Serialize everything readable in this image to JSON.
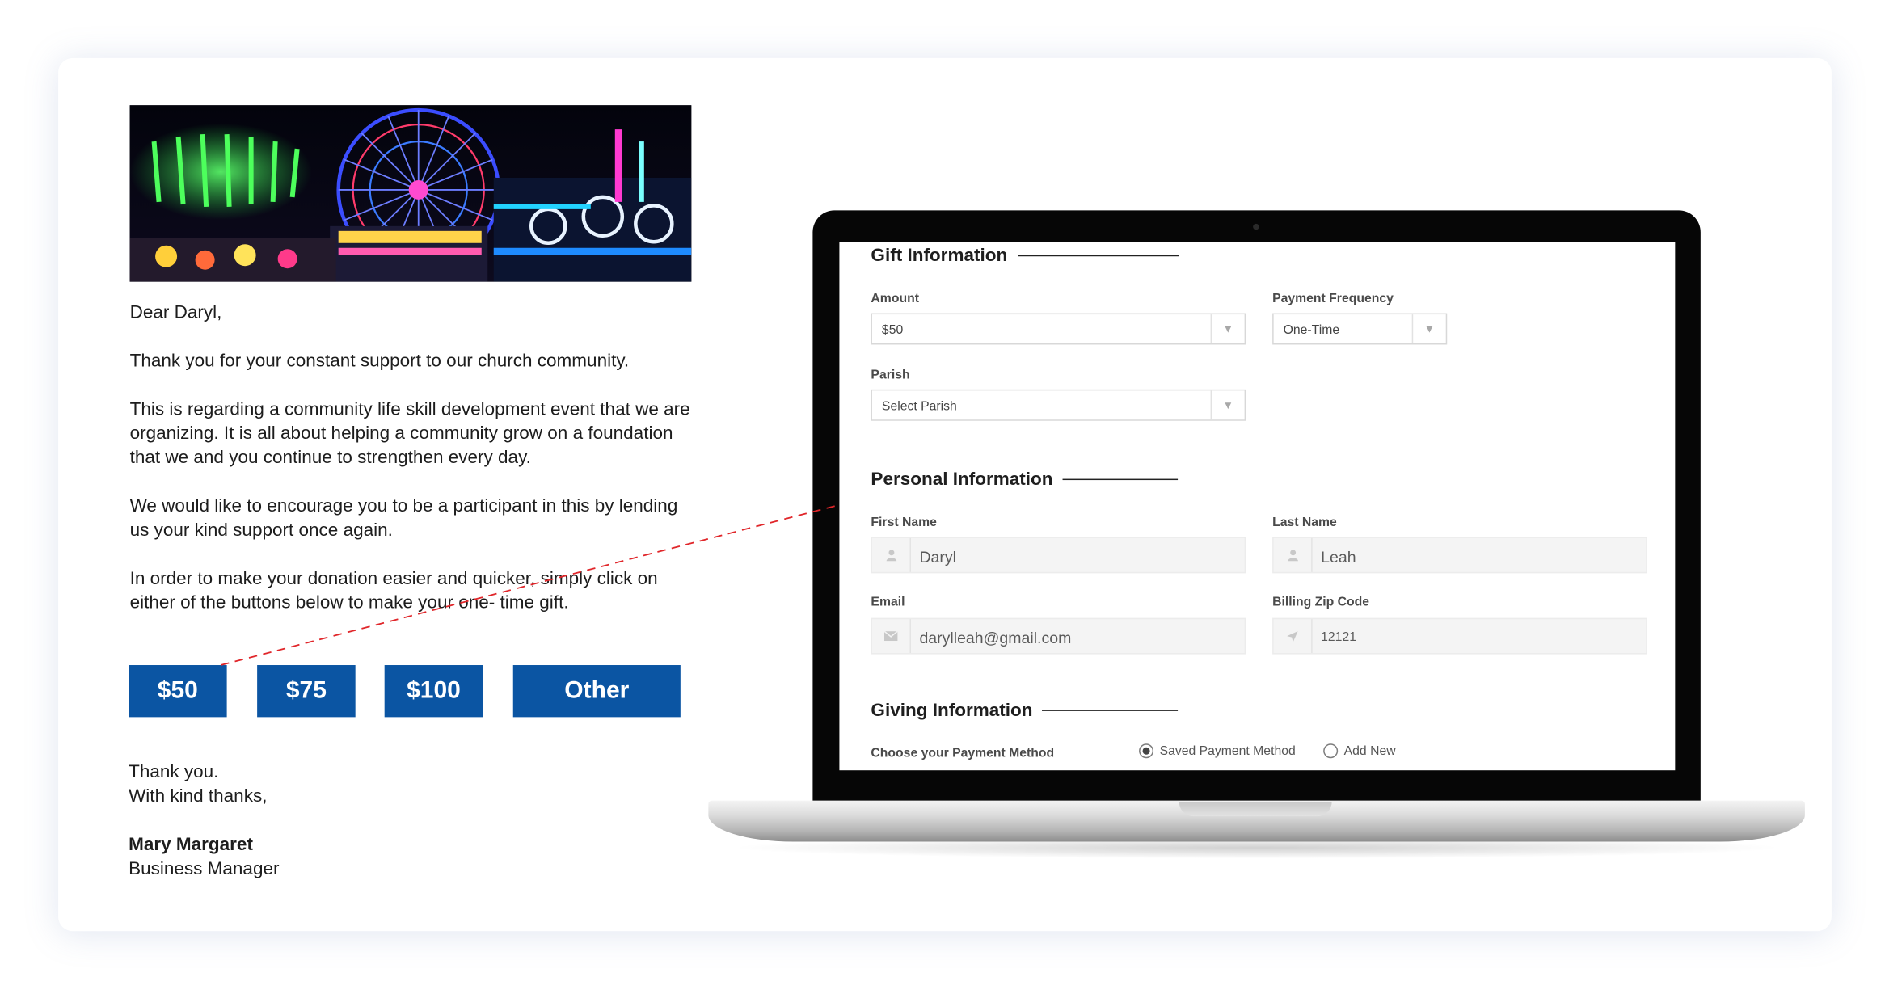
{
  "letter": {
    "greeting": "Dear Daryl,",
    "paragraphs": [
      "Thank you for your constant support to our church community.",
      "This is regarding a community life skill development event that we are organizing. It is all about helping a community grow on a foundation that we and you continue to strengthen every day.",
      "We would like to encourage you to be a participant in this by lending us your kind support once again.",
      "In order to make your donation easier and quicker, simply click on either of the buttons below to make your one- time gift."
    ],
    "buttons": [
      "$50",
      "$75",
      "$100",
      "Other"
    ],
    "closing_1": "Thank you.",
    "closing_2": "With kind thanks,",
    "signer_name": "Mary Margaret",
    "signer_title": "Business Manager"
  },
  "form": {
    "gift": {
      "title": "Gift Information",
      "amount_label": "Amount",
      "amount_value": "$50",
      "frequency_label": "Payment Frequency",
      "frequency_value": "One-Time",
      "parish_label": "Parish",
      "parish_value": "Select Parish"
    },
    "personal": {
      "title": "Personal Information",
      "first_name_label": "First Name",
      "first_name_value": "Daryl",
      "last_name_label": "Last Name",
      "last_name_value": "Leah",
      "email_label": "Email",
      "email_value": "darylleah@gmail.com",
      "zip_label": "Billing Zip Code",
      "zip_value": "12121"
    },
    "giving": {
      "title": "Giving Information",
      "method_label": "Choose your Payment Method",
      "option_saved": "Saved Payment Method",
      "option_new": "Add New",
      "selected": "Saved Payment Method"
    }
  },
  "colors": {
    "button_blue": "#0b55a3",
    "connector_red": "#e0262a"
  },
  "icons": {
    "caret": "chevron-down-icon",
    "user": "user-icon",
    "email": "envelope-icon",
    "location": "location-arrow-icon"
  }
}
